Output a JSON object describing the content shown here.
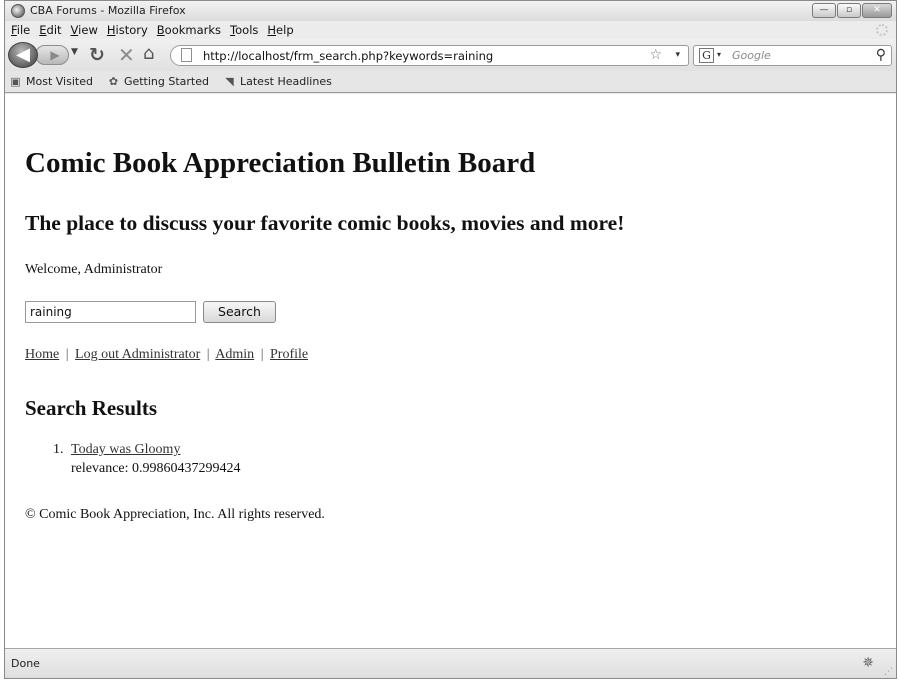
{
  "window": {
    "title": "CBA Forums - Mozilla Firefox",
    "controls": {
      "minimize": "—",
      "maximize": "▫",
      "close": "✕"
    }
  },
  "menu": [
    "File",
    "Edit",
    "View",
    "History",
    "Bookmarks",
    "Tools",
    "Help"
  ],
  "nav": {
    "url": "http://localhost/frm_search.php?keywords=raining",
    "search_engine_placeholder": "Google",
    "search_engine_letter": "G",
    "icons": {
      "back": "back-arrow-icon",
      "forward": "forward-arrow-icon",
      "reload": "reload-icon",
      "stop": "stop-icon",
      "home": "home-icon",
      "bookmark": "star-icon",
      "search": "magnifier-icon"
    }
  },
  "bookmarks": [
    {
      "label": "Most Visited",
      "icon": "most-visited-icon"
    },
    {
      "label": "Getting Started",
      "icon": "getting-started-icon"
    },
    {
      "label": "Latest Headlines",
      "icon": "rss-icon"
    }
  ],
  "page": {
    "title": "Comic Book Appreciation Bulletin Board",
    "tagline": "The place to discuss your favorite comic books, movies and more!",
    "welcome": "Welcome, Administrator",
    "search": {
      "value": "raining",
      "button_label": "Search"
    },
    "links": {
      "home": "Home",
      "logout": "Log out Administrator",
      "admin": "Admin",
      "profile": "Profile",
      "separator": "|"
    },
    "results_heading": "Search Results",
    "results": [
      {
        "num": "1.",
        "title": "Today was Gloomy",
        "relevance": "relevance: 0.99860437299424"
      }
    ],
    "footer": "© Comic Book Appreciation, Inc. All rights reserved."
  },
  "status": {
    "text": "Done"
  }
}
